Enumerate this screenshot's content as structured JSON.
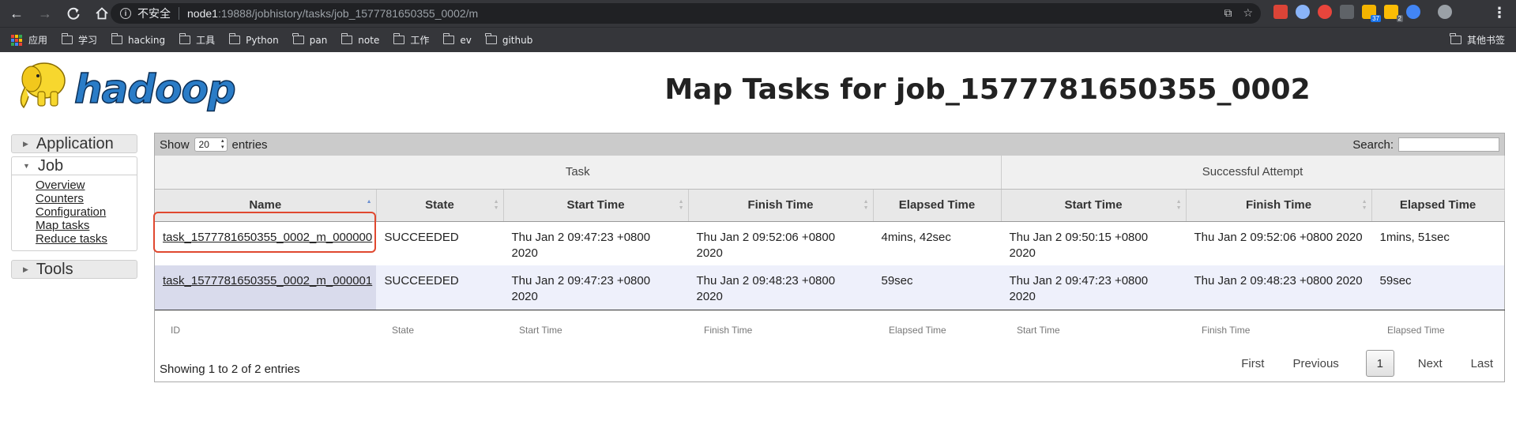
{
  "browser": {
    "security_label": "不安全",
    "url_host": "node1",
    "url_path": ":19888/jobhistory/tasks/job_1577781650355_0002/m",
    "extension_badges": [
      "37",
      "2"
    ],
    "bookmarks": [
      {
        "label": "应用",
        "icon": "apps-icon"
      },
      {
        "label": "学习",
        "icon": "folder-icon"
      },
      {
        "label": "hacking",
        "icon": "folder-icon"
      },
      {
        "label": "工具",
        "icon": "folder-icon"
      },
      {
        "label": "Python",
        "icon": "folder-icon"
      },
      {
        "label": "pan",
        "icon": "folder-icon"
      },
      {
        "label": "note",
        "icon": "folder-icon"
      },
      {
        "label": "工作",
        "icon": "folder-icon"
      },
      {
        "label": "ev",
        "icon": "folder-icon"
      },
      {
        "label": "github",
        "icon": "folder-icon"
      }
    ],
    "other_bookmarks": "其他书签"
  },
  "page": {
    "logo_text": "hadoop",
    "title": "Map Tasks for job_1577781650355_0002"
  },
  "sidebar": {
    "application": "Application",
    "job": "Job",
    "job_links": [
      "Overview",
      "Counters",
      "Configuration",
      "Map tasks",
      "Reduce tasks"
    ],
    "tools": "Tools"
  },
  "table": {
    "show_label": "Show",
    "page_size": "20",
    "entries_label": "entries",
    "search_label": "Search:",
    "groups": [
      "Task",
      "Successful Attempt"
    ],
    "columns": [
      "Name",
      "State",
      "Start Time",
      "Finish Time",
      "Elapsed Time",
      "Start Time",
      "Finish Time",
      "Elapsed Time"
    ],
    "rows": [
      [
        "task_1577781650355_0002_m_000000",
        "SUCCEEDED",
        "Thu Jan 2 09:47:23 +0800 2020",
        "Thu Jan 2 09:52:06 +0800 2020",
        "4mins, 42sec",
        "Thu Jan 2 09:50:15 +0800 2020",
        "Thu Jan 2 09:52:06 +0800 2020",
        "1mins, 51sec"
      ],
      [
        "task_1577781650355_0002_m_000001",
        "SUCCEEDED",
        "Thu Jan 2 09:47:23 +0800 2020",
        "Thu Jan 2 09:48:23 +0800 2020",
        "59sec",
        "Thu Jan 2 09:47:23 +0800 2020",
        "Thu Jan 2 09:48:23 +0800 2020",
        "59sec"
      ]
    ],
    "footer_filters": [
      "ID",
      "State",
      "Start Time",
      "Finish Time",
      "Elapsed Time",
      "Start Time",
      "Finish Time",
      "Elapsed Time"
    ],
    "showing_text": "Showing 1 to 2 of 2 entries",
    "pager": {
      "first": "First",
      "previous": "Previous",
      "current": "1",
      "next": "Next",
      "last": "Last"
    }
  },
  "colors": {
    "highlight": "#e0482f",
    "toolbar": "#35363a",
    "logo_yellow": "#f7d72e",
    "logo_blue": "#2a7cc7"
  }
}
